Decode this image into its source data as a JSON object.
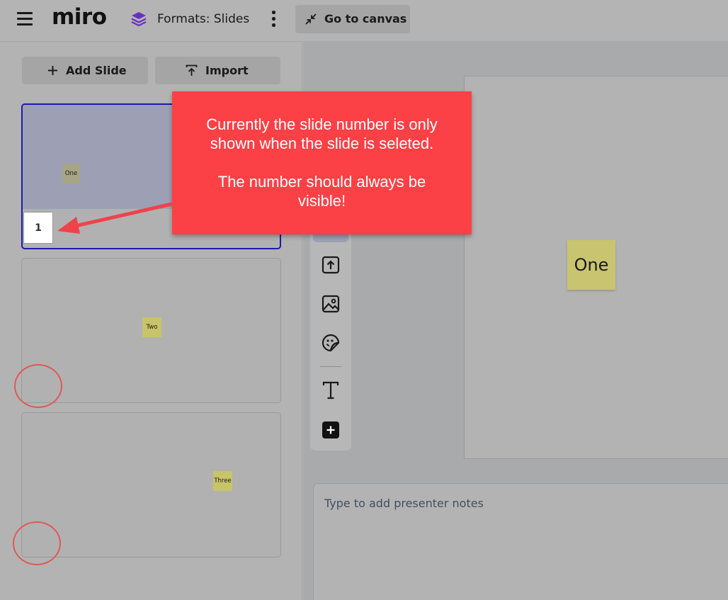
{
  "topbar": {
    "logo": "miro",
    "board_title": "Formats: Slides",
    "go_to_canvas_label": "Go to canvas"
  },
  "panel": {
    "add_slide_label": "Add Slide",
    "import_label": "Import",
    "slides": [
      {
        "sticky_text": "One",
        "number": "1",
        "selected": true
      },
      {
        "sticky_text": "Two",
        "selected": false
      },
      {
        "sticky_text": "Three",
        "selected": false
      }
    ]
  },
  "canvas": {
    "sticky_text": "One"
  },
  "notes": {
    "placeholder": "Type to add presenter notes"
  },
  "annotation": {
    "line1": "Currently the slide number is only",
    "line2": "shown when the slide is seleted.",
    "line3": "The number should always be",
    "line4": "visible!"
  },
  "toolbar": {
    "tools": [
      "upload-icon",
      "image-icon",
      "sticker-icon",
      "text-icon",
      "plus-icon"
    ]
  },
  "colors": {
    "selected_border": "#1c1ca8",
    "callout_bg": "#fc4146",
    "highlight_circle": "#e05858",
    "sticky": "#c9c46f",
    "board_icon": "#6a2fc0"
  }
}
